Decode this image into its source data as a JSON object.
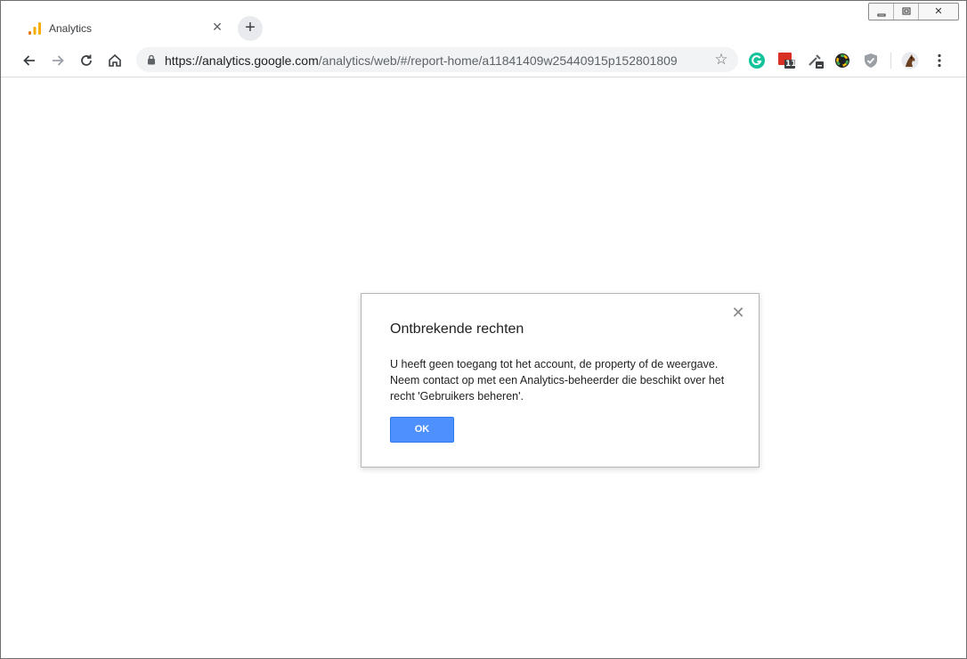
{
  "window": {
    "controls": {
      "minimize": "▭",
      "restore": "▣",
      "close": "✕"
    }
  },
  "tab": {
    "title": "Analytics",
    "favicon": "analytics-bars-icon",
    "close_glyph": "✕"
  },
  "newtab": {
    "glyph": "+"
  },
  "toolbar": {
    "url_host": "https://analytics.google.com",
    "url_path": "/analytics/web/#/report-home/a11841409w25440915p152801809",
    "star_glyph": "☆",
    "extensions": [
      "grammarly-icon",
      "calendar-11-icon",
      "eyedropper-icon",
      "color-wheel-icon",
      "shield-icon"
    ],
    "calendar_badge": "11",
    "menu_glyph": "⋮"
  },
  "dialog": {
    "title": "Ontbrekende rechten",
    "body": "U heeft geen toegang tot het account, de property of de weergave. Neem contact op met een Analytics-beheerder die beschikt over het recht 'Gebruikers beheren'.",
    "ok_label": "OK",
    "close_glyph": "✕"
  },
  "colors": {
    "accent": "#4d90fe",
    "omnibox_bg": "#f1f3f4",
    "analytics_orange": "#f9ab00",
    "analytics_dark_orange": "#e37400"
  }
}
